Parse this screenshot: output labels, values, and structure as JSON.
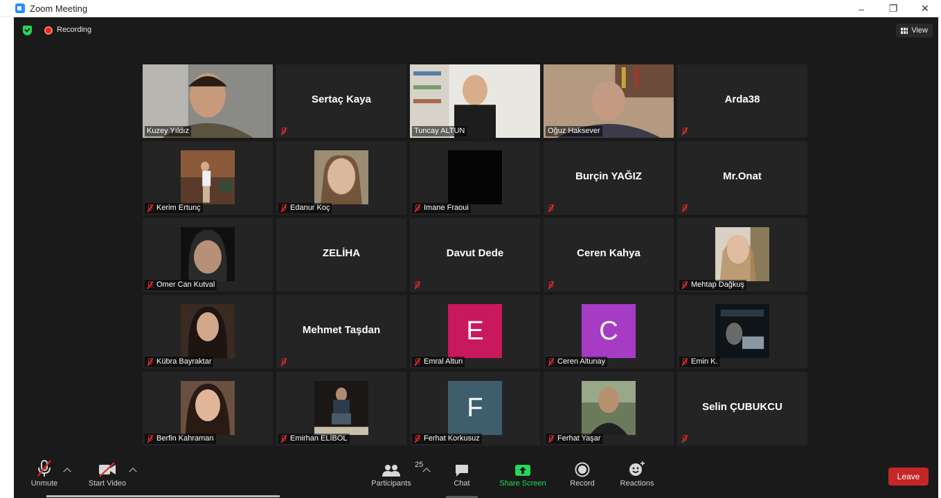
{
  "window": {
    "title": "Zoom Meeting",
    "controls": [
      "–",
      "❐",
      "✕"
    ]
  },
  "topbar": {
    "recording_label": "Recording",
    "view_label": "View"
  },
  "participants": [
    {
      "name": "Kuzey Yıldız",
      "type": "video",
      "muted": false,
      "scene": "man-smile"
    },
    {
      "name": "Sertaç Kaya",
      "type": "name",
      "muted": true
    },
    {
      "name": "Tuncay ALTUN",
      "type": "video",
      "muted": false,
      "scene": "man-shelf"
    },
    {
      "name": "Oğuz Haksever",
      "type": "video",
      "muted": false,
      "active": true,
      "scene": "man-books"
    },
    {
      "name": "Arda38",
      "type": "name",
      "muted": true
    },
    {
      "name": "Kerim Ertunç",
      "type": "photo",
      "muted": true,
      "scene": "street"
    },
    {
      "name": "Edanur Koç",
      "type": "photo",
      "muted": true,
      "scene": "portrait-woman"
    },
    {
      "name": "Imane Fraoui",
      "type": "photo",
      "muted": true,
      "scene": "black"
    },
    {
      "name": "Burçin YAĞIZ",
      "type": "name",
      "muted": true
    },
    {
      "name": "Mr.Onat",
      "type": "name",
      "muted": true
    },
    {
      "name": "Omer Can Kutval",
      "type": "photo",
      "muted": true,
      "scene": "hood"
    },
    {
      "name": "ZELİHA",
      "type": "name",
      "muted": false
    },
    {
      "name": "Davut Dede",
      "type": "name",
      "muted": true
    },
    {
      "name": "Ceren Kahya",
      "type": "name",
      "muted": true
    },
    {
      "name": "Mehtap Dağkuş",
      "type": "photo",
      "muted": true,
      "scene": "woman-light"
    },
    {
      "name": "Kübra Bayraktar",
      "type": "photo",
      "muted": true,
      "scene": "woman-dark"
    },
    {
      "name": "Mehmet Taşdan",
      "type": "name",
      "muted": true
    },
    {
      "name": "Emral Altun",
      "type": "letter",
      "muted": true,
      "letter": "E",
      "color": "#C8185E"
    },
    {
      "name": "Ceren Altunay",
      "type": "letter",
      "muted": true,
      "letter": "C",
      "color": "#A63CC4"
    },
    {
      "name": "Emin K.",
      "type": "photo",
      "muted": true,
      "scene": "poster"
    },
    {
      "name": "Berfin Kahraman",
      "type": "photo",
      "muted": true,
      "scene": "woman-smile"
    },
    {
      "name": "Emirhan ELİBOL",
      "type": "photo",
      "muted": true,
      "scene": "man-sit"
    },
    {
      "name": "Ferhat Korkusuz",
      "type": "letter",
      "muted": true,
      "letter": "F",
      "color": "#3E5E6E"
    },
    {
      "name": "Ferhat Yaşar",
      "type": "photo",
      "muted": true,
      "scene": "man-outdoor"
    },
    {
      "name": "Selin ÇUBUKCU",
      "type": "name",
      "muted": true
    }
  ],
  "toolbar": {
    "unmute_label": "Unmute",
    "start_video_label": "Start Video",
    "participants_label": "Participants",
    "participants_count": "25",
    "chat_label": "Chat",
    "share_screen_label": "Share Screen",
    "record_label": "Record",
    "reactions_label": "Reactions",
    "leave_label": "Leave"
  },
  "colors": {
    "active_speaker": "#E6E27A",
    "muted": "#E02828",
    "share": "#23D959",
    "leave": "#C52626"
  }
}
